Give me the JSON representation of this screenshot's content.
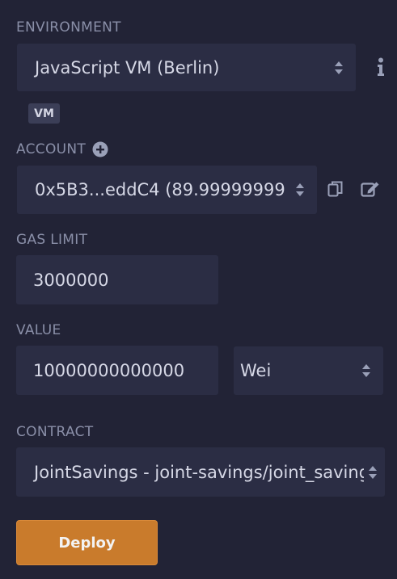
{
  "environment": {
    "label": "ENVIRONMENT",
    "selected": "JavaScript VM (Berlin)",
    "badge": "VM"
  },
  "account": {
    "label": "ACCOUNT",
    "selected": "0x5B3...eddC4 (89.99999999"
  },
  "gas_limit": {
    "label": "GAS LIMIT",
    "value": "3000000"
  },
  "value": {
    "label": "VALUE",
    "amount": "10000000000000",
    "unit": "Wei"
  },
  "contract": {
    "label": "CONTRACT",
    "selected": "JointSavings - joint-savings/joint_savings"
  },
  "deploy_button": {
    "label": "Deploy"
  },
  "colors": {
    "background": "#222336",
    "field": "#2b2d44",
    "label_text": "#8a8fa8",
    "field_text": "#d6d8e6",
    "deploy": "#c97b2c"
  },
  "icons": [
    "info-icon",
    "plus-circle-icon",
    "copy-icon",
    "edit-icon",
    "sort-arrows-icon"
  ]
}
